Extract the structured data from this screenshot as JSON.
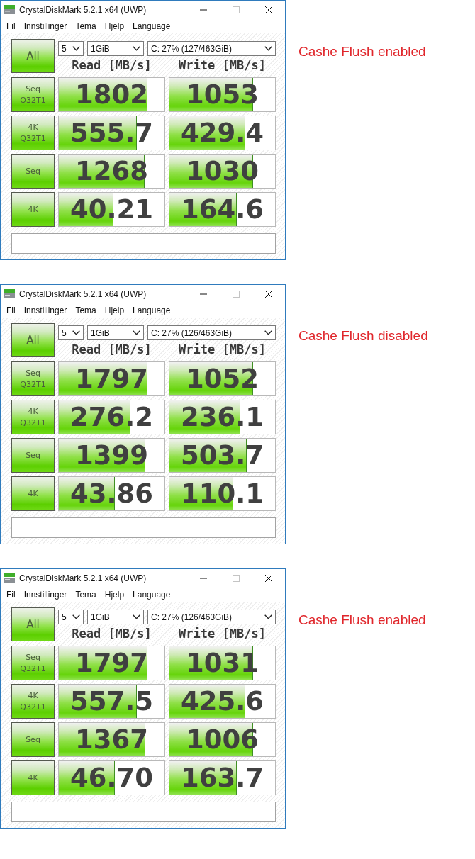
{
  "panels": [
    {
      "caption": "Cashe Flush enabled",
      "window": {
        "title": "CrystalDiskMark 5.2.1 x64 (UWP)",
        "controls": [
          {
            "kind": "minimize",
            "disabled": false
          },
          {
            "kind": "maximize",
            "disabled": true
          },
          {
            "kind": "close",
            "disabled": false
          }
        ],
        "menu": [
          "Fil",
          "Innstillinger",
          "Tema",
          "Hjelp",
          "Language"
        ],
        "all_button": "All",
        "count": "5",
        "size": "1GiB",
        "drive": "C: 27% (127/463GiB)",
        "columns": [
          "Read [MB/s]",
          "Write [MB/s]"
        ],
        "rows": [
          {
            "label": "Seq\nQ32T1",
            "read": {
              "value": "1802",
              "level": 0.84
            },
            "write": {
              "value": "1053",
              "level": 0.795
            }
          },
          {
            "label": "4K\nQ32T1",
            "read": {
              "value": "555.7",
              "level": 0.74
            },
            "write": {
              "value": "429.4",
              "level": 0.72
            }
          },
          {
            "label": "Seq",
            "read": {
              "value": "1268",
              "level": 0.81
            },
            "write": {
              "value": "1030",
              "level": 0.794
            }
          },
          {
            "label": "4K",
            "read": {
              "value": "40.21",
              "level": 0.52
            },
            "write": {
              "value": "164.6",
              "level": 0.64
            }
          }
        ]
      }
    },
    {
      "caption": "Cashe Flush disabled",
      "window": {
        "title": "CrystalDiskMark 5.2.1 x64 (UWP)",
        "controls": [
          {
            "kind": "minimize",
            "disabled": false
          },
          {
            "kind": "maximize",
            "disabled": true
          },
          {
            "kind": "close",
            "disabled": false
          }
        ],
        "menu": [
          "Fil",
          "Innstillinger",
          "Tema",
          "Hjelp",
          "Language"
        ],
        "all_button": "All",
        "count": "5",
        "size": "1GiB",
        "drive": "C: 27% (126/463GiB)",
        "columns": [
          "Read [MB/s]",
          "Write [MB/s]"
        ],
        "rows": [
          {
            "label": "Seq\nQ32T1",
            "read": {
              "value": "1797",
              "level": 0.84
            },
            "write": {
              "value": "1052",
              "level": 0.795
            }
          },
          {
            "label": "4K\nQ32T1",
            "read": {
              "value": "276.2",
              "level": 0.68
            },
            "write": {
              "value": "236.1",
              "level": 0.67
            }
          },
          {
            "label": "Seq",
            "read": {
              "value": "1399",
              "level": 0.82
            },
            "write": {
              "value": "503.7",
              "level": 0.733
            }
          },
          {
            "label": "4K",
            "read": {
              "value": "43.86",
              "level": 0.528
            },
            "write": {
              "value": "110.1",
              "level": 0.605
            }
          }
        ]
      }
    },
    {
      "caption": "Cashe Flush enabled",
      "window": {
        "title": "CrystalDiskMark 5.2.1 x64 (UWP)",
        "controls": [
          {
            "kind": "minimize",
            "disabled": false
          },
          {
            "kind": "maximize",
            "disabled": true
          },
          {
            "kind": "close",
            "disabled": false
          }
        ],
        "menu": [
          "Fil",
          "Innstillinger",
          "Tema",
          "Hjelp",
          "Language"
        ],
        "all_button": "All",
        "count": "5",
        "size": "1GiB",
        "drive": "C: 27% (126/463GiB)",
        "columns": [
          "Read [MB/s]",
          "Write [MB/s]"
        ],
        "rows": [
          {
            "label": "Seq\nQ32T1",
            "read": {
              "value": "1797",
              "level": 0.84
            },
            "write": {
              "value": "1031",
              "level": 0.794
            }
          },
          {
            "label": "4K\nQ32T1",
            "read": {
              "value": "557.5",
              "level": 0.74
            },
            "write": {
              "value": "425.6",
              "level": 0.72
            }
          },
          {
            "label": "Seq",
            "read": {
              "value": "1367",
              "level": 0.817
            },
            "write": {
              "value": "1006",
              "level": 0.792
            }
          },
          {
            "label": "4K",
            "read": {
              "value": "46.70",
              "level": 0.533
            },
            "write": {
              "value": "163.7",
              "level": 0.64
            }
          }
        ]
      }
    }
  ]
}
